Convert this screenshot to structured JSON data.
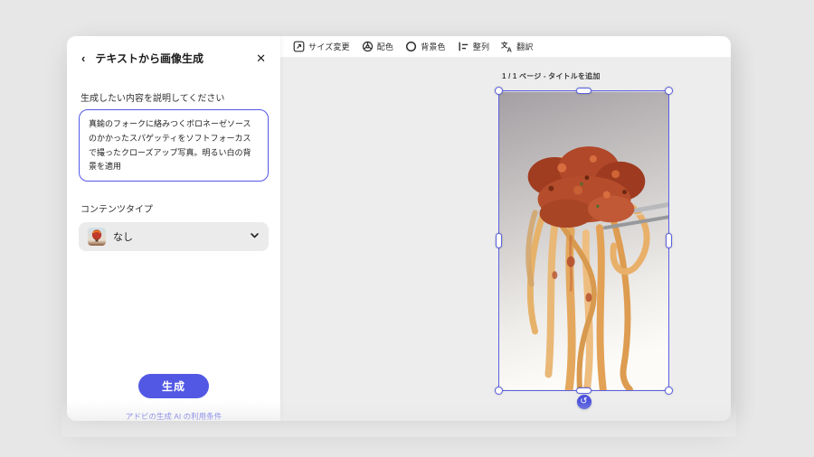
{
  "panel": {
    "title": "テキストから画像生成",
    "prompt_label": "生成したい内容を説明してください",
    "prompt_value": "真鍮のフォークに絡みつくボロネーゼソースのかかったスパゲッティをソフトフォーカスで撮ったクローズアップ写真。明るい白の背景を適用",
    "content_type_label": "コンテンツタイプ",
    "content_type_value": "なし",
    "generate_label": "生成",
    "terms_link": "アドビの生成 AI の利用条件"
  },
  "toolbar": {
    "items": [
      {
        "icon": "resize-icon",
        "label": "サイズ変更"
      },
      {
        "icon": "color-wheel-icon",
        "label": "配色"
      },
      {
        "icon": "background-color-icon",
        "label": "背景色"
      },
      {
        "icon": "align-icon",
        "label": "整列"
      },
      {
        "icon": "translate-icon",
        "label": "翻訳"
      }
    ]
  },
  "canvas": {
    "page_indicator": "1 / 1 ページ - タイトルを追加",
    "image_alt": "真鍮のフォークに絡みつくボロネーゼソースのかかったスパゲッティのクローズアップ写真"
  },
  "colors": {
    "accent": "#5258e4",
    "selection": "#5a5fe0",
    "canvas_bg": "#ededee",
    "page_bg": "#e7e7e7"
  }
}
